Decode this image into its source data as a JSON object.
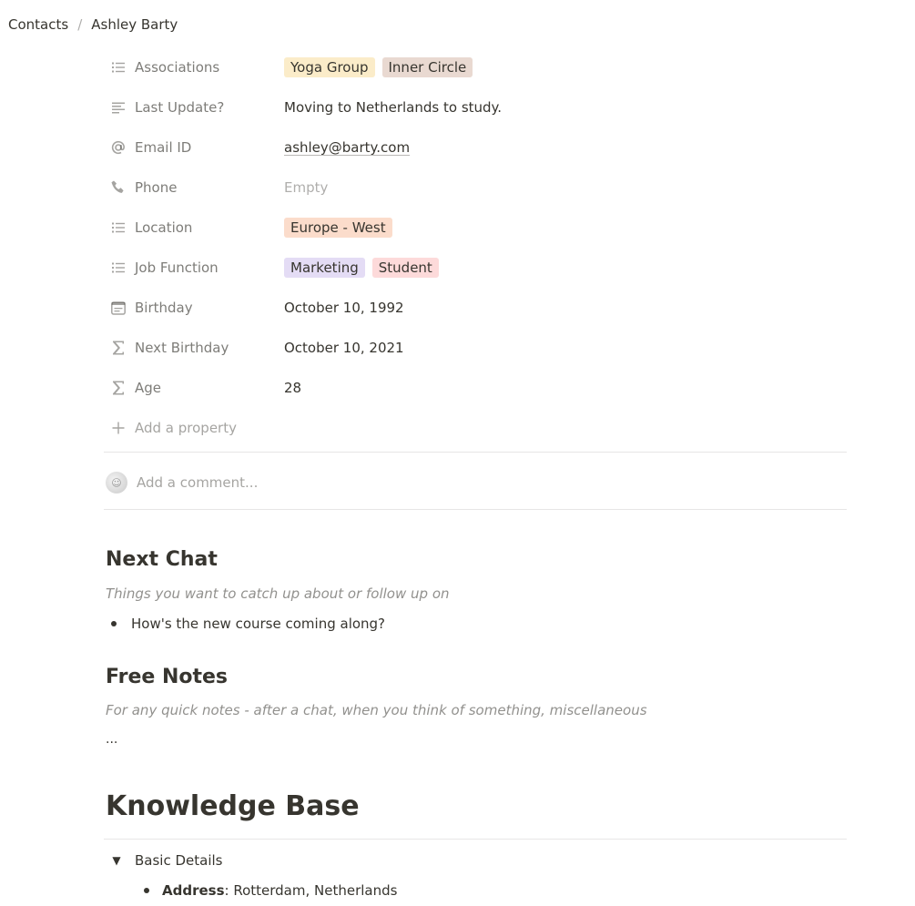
{
  "breadcrumb": {
    "parent": "Contacts",
    "separator": "/",
    "current": "Ashley Barty"
  },
  "properties": [
    {
      "name": "Associations",
      "icon": "list-icon",
      "type": "tags",
      "tags": [
        {
          "label": "Yoga Group",
          "color": "#fbecc9"
        },
        {
          "label": "Inner Circle",
          "color": "#e9d9d1"
        }
      ]
    },
    {
      "name": "Last Update?",
      "icon": "text-icon",
      "type": "text",
      "value": "Moving to Netherlands to study."
    },
    {
      "name": "Email ID",
      "icon": "at-icon",
      "type": "email",
      "value": "ashley@barty.com"
    },
    {
      "name": "Phone",
      "icon": "phone-icon",
      "type": "empty",
      "value": "Empty"
    },
    {
      "name": "Location",
      "icon": "list-icon",
      "type": "tags",
      "tags": [
        {
          "label": "Europe - West",
          "color": "#fbdccb"
        }
      ]
    },
    {
      "name": "Job Function",
      "icon": "list-icon",
      "type": "tags",
      "tags": [
        {
          "label": "Marketing",
          "color": "#e4dcf5"
        },
        {
          "label": "Student",
          "color": "#fddada"
        }
      ]
    },
    {
      "name": "Birthday",
      "icon": "calendar-icon",
      "type": "text",
      "value": "October 10, 1992"
    },
    {
      "name": "Next Birthday",
      "icon": "sigma-icon",
      "type": "text",
      "value": "October 10, 2021"
    },
    {
      "name": "Age",
      "icon": "sigma-icon",
      "type": "text",
      "value": "28"
    }
  ],
  "add_property_label": "Add a property",
  "comment_placeholder": "Add a comment...",
  "next_chat": {
    "heading": "Next Chat",
    "hint": "Things you want to catch up about or follow up on",
    "items": [
      "How's the new course coming along?"
    ]
  },
  "free_notes": {
    "heading": "Free Notes",
    "hint": "For any quick notes - after a chat, when you think of something, miscellaneous",
    "body": "..."
  },
  "knowledge_base": {
    "heading": "Knowledge Base",
    "toggle_label": "Basic Details",
    "address_label": "Address",
    "address_value": ": Rotterdam, Netherlands"
  }
}
